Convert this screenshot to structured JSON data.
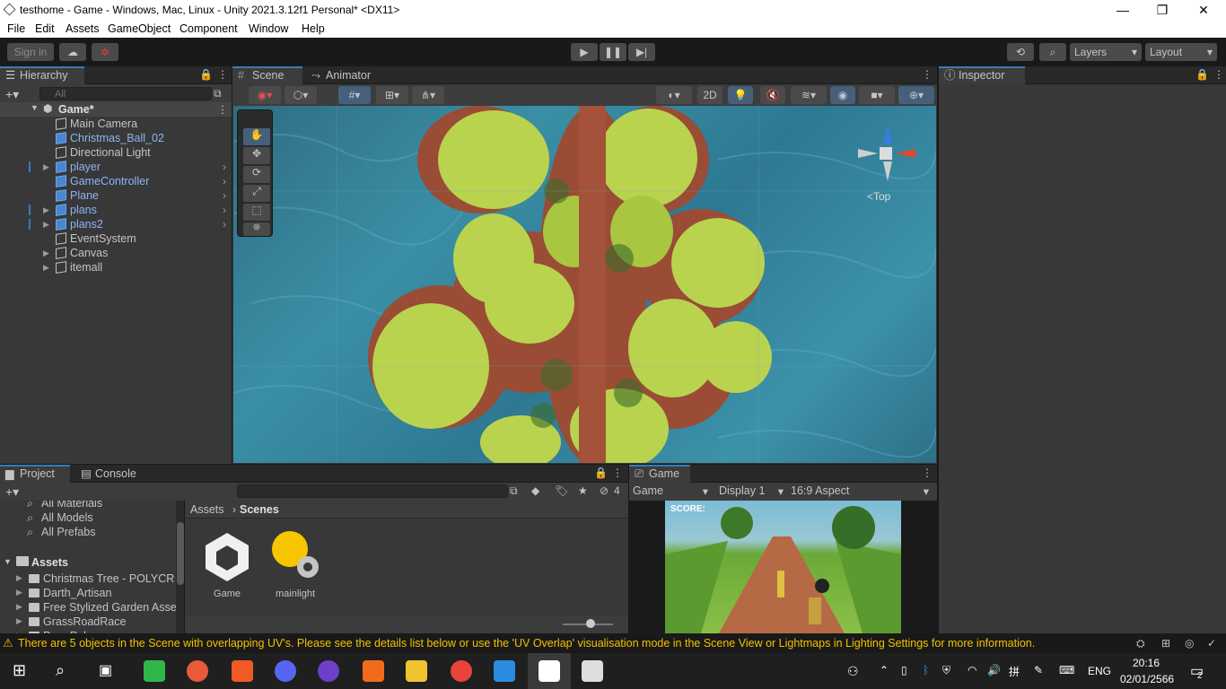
{
  "window": {
    "title": "testhome - Game - Windows, Mac, Linux - Unity 2021.3.12f1 Personal* <DX11>",
    "minimize": "—",
    "restore": "❐",
    "close": "✕"
  },
  "menu": [
    "File",
    "Edit",
    "Assets",
    "GameObject",
    "Component",
    "Window",
    "Help"
  ],
  "toolbar": {
    "sign_in": "Sign in",
    "layers": "Layers",
    "layout": "Layout"
  },
  "hierarchy": {
    "tab": "Hierarchy",
    "search_placeholder": "All",
    "root": "Game*",
    "items": [
      {
        "label": "Main Camera",
        "blue": false,
        "arrow": false
      },
      {
        "label": "Christmas_Ball_02",
        "blue": true,
        "arrow": false
      },
      {
        "label": "Directional Light",
        "blue": false,
        "arrow": false
      },
      {
        "label": "player",
        "blue": true,
        "arrow": true
      },
      {
        "label": "GameController",
        "blue": true,
        "arrow": false
      },
      {
        "label": "Plane",
        "blue": true,
        "arrow": false
      },
      {
        "label": "plans",
        "blue": true,
        "arrow": true
      },
      {
        "label": "plans2",
        "blue": true,
        "arrow": true
      },
      {
        "label": "EventSystem",
        "blue": false,
        "arrow": false
      },
      {
        "label": "Canvas",
        "blue": false,
        "arrow": true
      },
      {
        "label": "itemall",
        "blue": false,
        "arrow": true
      }
    ]
  },
  "scene": {
    "tab": "Scene",
    "tab2": "Animator",
    "btn_2d": "2D",
    "gizmo_label": "<Top"
  },
  "inspector": {
    "tab": "Inspector"
  },
  "project": {
    "tab": "Project",
    "tab2": "Console",
    "hidden_count": "4",
    "favorites": [
      "All Materials",
      "All Models",
      "All Prefabs"
    ],
    "assets_root": "Assets",
    "folders": [
      "Christmas Tree - POLYCR",
      "Darth_Artisan",
      "Free Stylized Garden Asse",
      "GrassRoadRace",
      "Pure Poly"
    ],
    "breadcrumb": [
      "Assets",
      "Scenes"
    ],
    "files": [
      {
        "name": "Game",
        "icon": "unity-scene-icon"
      },
      {
        "name": "mainlight",
        "icon": "lighting-settings-icon"
      }
    ]
  },
  "game": {
    "tab": "Game",
    "display_mode": "Game",
    "display": "Display 1",
    "aspect": "16:9 Aspect",
    "score_label": "SCORE:"
  },
  "status": {
    "message": "There are 5 objects in the Scene with overlapping UV's. Please see the details list below or use the 'UV Overlap' visualisation mode in the Scene View or Lightmaps in Lighting Settings for more information."
  },
  "taskbar": {
    "lang": "ENG",
    "time": "20:16",
    "date": "02/01/2566",
    "notif": "2"
  },
  "colors": {
    "accent": "#3a79bb",
    "link_blue": "#8ab6f2",
    "warning": "#f2c200"
  }
}
